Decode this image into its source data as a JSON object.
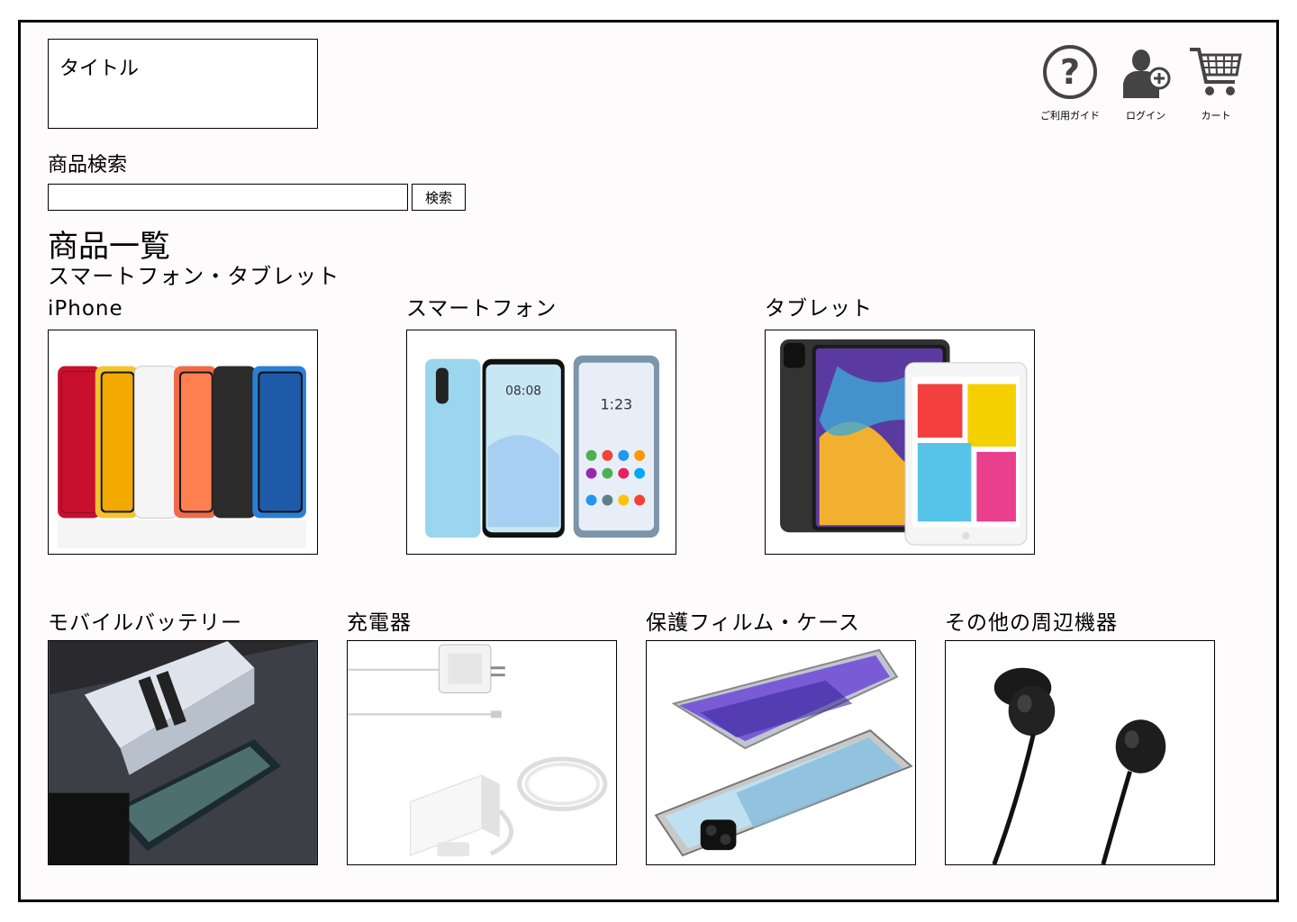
{
  "header": {
    "title_box": "タイトル"
  },
  "nav": {
    "guide_label": "ご利用ガイド",
    "login_label": "ログイン",
    "cart_label": "カート"
  },
  "search": {
    "label": "商品検索",
    "value": "",
    "placeholder": "",
    "button_label": "検索"
  },
  "main": {
    "list_title": "商品一覧",
    "section_title": "スマートフォン・タブレット",
    "categories_row1": [
      {
        "label": "iPhone",
        "image": "iphone-lineup"
      },
      {
        "label": "スマートフォン",
        "image": "android-phones"
      },
      {
        "label": "タブレット",
        "image": "tablets"
      }
    ],
    "categories_row2": [
      {
        "label": "モバイルバッテリー",
        "image": "power-bank"
      },
      {
        "label": "充電器",
        "image": "charger"
      },
      {
        "label": "保護フィルム・ケース",
        "image": "phone-case"
      },
      {
        "label": "その他の周辺機器",
        "image": "earphones"
      }
    ]
  },
  "icons": {
    "guide": "question-circle-icon",
    "login": "user-add-icon",
    "cart": "cart-icon"
  },
  "colors": {
    "frame_border": "#000000",
    "background": "#fdfbfc",
    "icon": "#444444"
  }
}
